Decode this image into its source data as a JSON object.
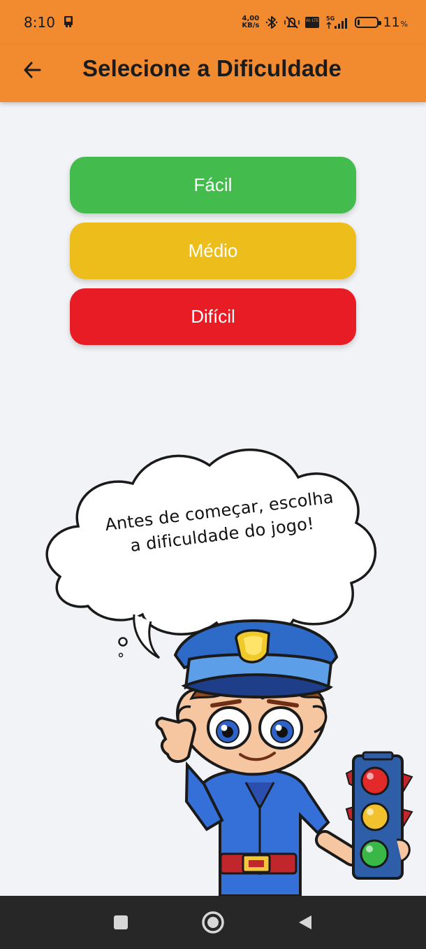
{
  "status_bar": {
    "time": "8:10",
    "net_speed_value": "4,00",
    "net_speed_unit": "KB/s",
    "network_label": "5G",
    "volte_label": "Vo LTE",
    "battery_percent": "11",
    "battery_unit": "%",
    "battery_level": 0.11,
    "icons": [
      "device-notification-icon",
      "bluetooth-icon",
      "muted-vibrate-icon",
      "volte-icon",
      "signal-icon",
      "battery-icon"
    ]
  },
  "app_bar": {
    "title": "Selecione a Dificuldade",
    "back_icon": "arrow-left-icon"
  },
  "difficulty": {
    "options": [
      {
        "label": "Fácil",
        "color": "#43BC4D"
      },
      {
        "label": "Médio",
        "color": "#EDBE1B"
      },
      {
        "label": "Difícil",
        "color": "#E71C25"
      }
    ]
  },
  "mascot": {
    "speech_line_1": "Antes de começar, escolha",
    "speech_line_2": "a dificuldade do jogo!",
    "icons": [
      "police-officer-icon",
      "traffic-light-icon",
      "thought-bubble-icon"
    ]
  },
  "navigation": {
    "icons": [
      "recents-square-icon",
      "home-circle-icon",
      "back-triangle-icon"
    ]
  },
  "colors": {
    "accent": "#F28A30",
    "background": "#F2F3F7",
    "nav_bar": "#272727"
  }
}
